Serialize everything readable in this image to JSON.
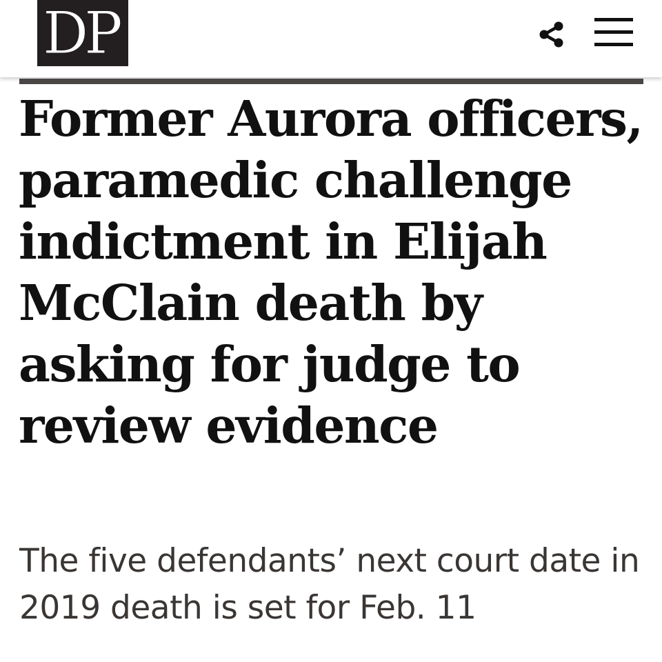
{
  "header": {
    "logo_text": "DP",
    "share_icon": "share-icon",
    "menu_icon": "hamburger-menu-icon"
  },
  "article": {
    "headline": "Former Aurora officers, paramedic challenge indictment in Elijah McClain death by asking for judge to review evidence",
    "subheadline": "The five defendants’ next court date in 2019 death is set for Feb. 11"
  },
  "colors": {
    "logo_background": "#231f20",
    "rule": "#4a4645",
    "headline_text": "#111111",
    "subhead_text": "#3a3634"
  }
}
